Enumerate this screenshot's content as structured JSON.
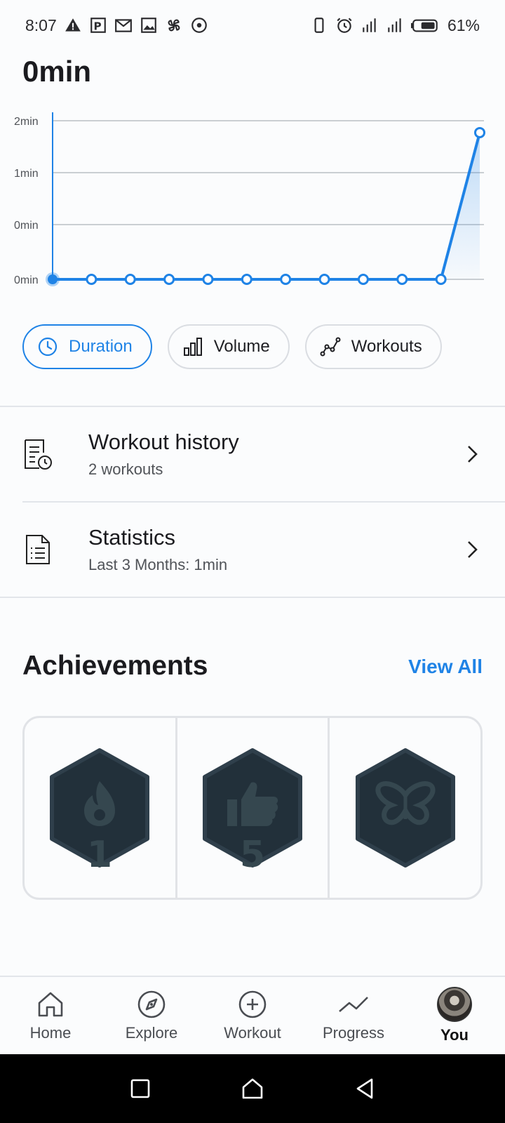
{
  "status_bar": {
    "time": "8:07",
    "battery": "61%",
    "left_icons": [
      "warning-icon",
      "parking-icon",
      "gmail-icon",
      "gallery-icon",
      "pinwheel-icon",
      "target-icon"
    ],
    "right_icons": [
      "vibrate-icon",
      "alarm-icon",
      "signal-icon",
      "signal-icon",
      "battery-icon"
    ]
  },
  "summary": {
    "value": "0min"
  },
  "chart_data": {
    "type": "line",
    "y_tick_labels": [
      "2min",
      "1min",
      "0min",
      "0min"
    ],
    "values": [
      0,
      0,
      0,
      0,
      0,
      0,
      0,
      0,
      0,
      0,
      0,
      1.85
    ],
    "ylim": [
      0,
      2
    ],
    "grid": true,
    "color": "#1f83e6"
  },
  "chips": [
    {
      "label": "Duration",
      "icon": "clock-icon",
      "active": true
    },
    {
      "label": "Volume",
      "icon": "bar-chart-icon",
      "active": false
    },
    {
      "label": "Workouts",
      "icon": "line-chart-icon",
      "active": false
    }
  ],
  "menu": {
    "history": {
      "title": "Workout history",
      "subtitle": "2 workouts"
    },
    "statistics": {
      "title": "Statistics",
      "subtitle": "Last 3 Months: 1min"
    }
  },
  "achievements": {
    "title": "Achievements",
    "view_all": "View All",
    "badges": [
      {
        "icon": "flame-icon",
        "number": "1"
      },
      {
        "icon": "thumbs-up-icon",
        "number": "5"
      },
      {
        "icon": "butterfly-icon",
        "number": ""
      }
    ]
  },
  "bottom_nav": [
    {
      "label": "Home",
      "icon": "home-icon"
    },
    {
      "label": "Explore",
      "icon": "compass-icon"
    },
    {
      "label": "Workout",
      "icon": "plus-circle-icon"
    },
    {
      "label": "Progress",
      "icon": "trend-icon"
    },
    {
      "label": "You",
      "icon": "avatar",
      "active": true
    }
  ]
}
